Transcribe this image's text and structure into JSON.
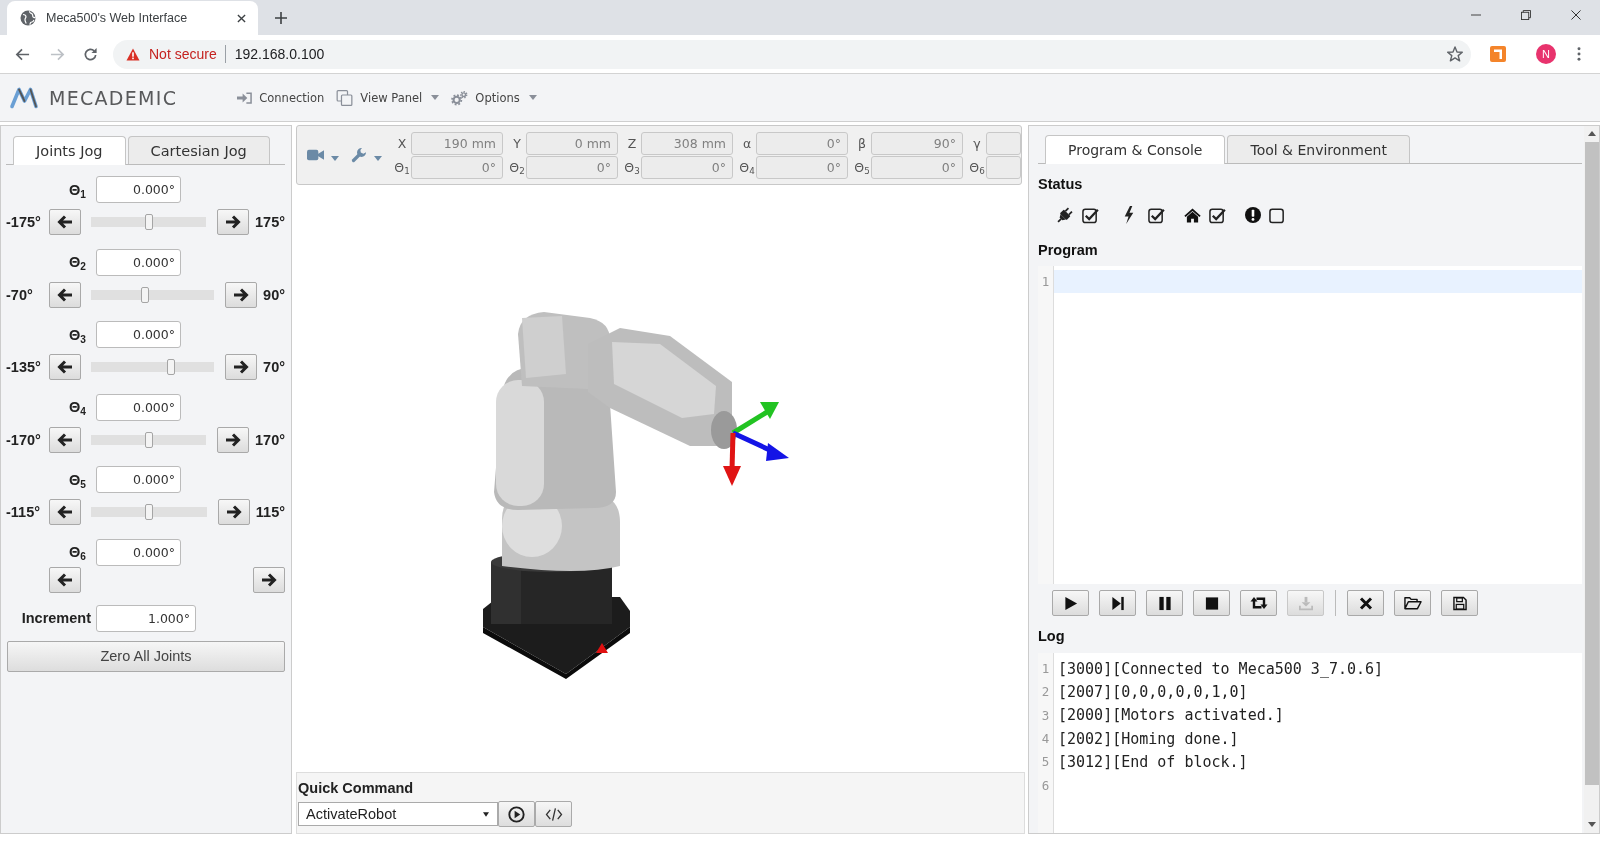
{
  "browser": {
    "tabs": [
      {
        "title": "Meca500's Web Interface",
        "selected": true
      }
    ],
    "forward_disabled": true,
    "security_label": "Not secure",
    "url": "192.168.0.100",
    "profile_initial": "N"
  },
  "app_header": {
    "logo": "MECADEMIC",
    "menu": [
      {
        "label": "Connection",
        "dropdown": false
      },
      {
        "label": "View Panel",
        "dropdown": true
      },
      {
        "label": "Options",
        "dropdown": true
      }
    ]
  },
  "jog_panel": {
    "tabs": [
      {
        "label": "Joints Jog",
        "selected": true
      },
      {
        "label": "Cartesian Jog",
        "selected": false
      }
    ],
    "joints": [
      {
        "label": "Θ$_{1}$",
        "value": "0.000°",
        "min": "-175°",
        "max": "175°",
        "level": 0.5
      },
      {
        "label": "Θ$_{2}$",
        "value": "0.000°",
        "min": "-70°",
        "max": "90°",
        "level": 0.44
      },
      {
        "label": "Θ$_{3}$",
        "value": "0.000°",
        "min": "-135°",
        "max": "70°",
        "level": 0.65
      },
      {
        "label": "Θ$_{4}$",
        "value": "0.000°",
        "min": "-170°",
        "max": "170°",
        "level": 0.5
      },
      {
        "label": "Θ$_{5}$",
        "value": "0.000°",
        "min": "-115°",
        "max": "115°",
        "level": 0.5
      },
      {
        "label": "Θ$_{6}$",
        "value": "0.000°"
      }
    ],
    "increment": {
      "label": "Increment",
      "value": "1.000°"
    },
    "zero_button": "Zero All Joints"
  },
  "viewer": {
    "pose_rows": [
      {
        "fields": [
          {
            "label": "X",
            "value": "190 mm"
          },
          {
            "label": "Y",
            "value": "0 mm"
          },
          {
            "label": "Z",
            "value": "308 mm"
          },
          {
            "label": "α",
            "value": "0°"
          },
          {
            "label": "β",
            "value": "90°"
          },
          {
            "label": "γ"
          }
        ]
      },
      {
        "fields": [
          {
            "label": "Θ$_{1}$",
            "value": "0°"
          },
          {
            "label": "Θ$_{2}$",
            "value": "0°"
          },
          {
            "label": "Θ$_{3}$",
            "value": "0°"
          },
          {
            "label": "Θ$_{4}$",
            "value": "0°"
          },
          {
            "label": "Θ$_{5}$",
            "value": "0°"
          },
          {
            "label": "Θ$_{6}$"
          }
        ]
      }
    ],
    "quick_command": {
      "label": "Quick Command",
      "value": "ActivateRobot"
    }
  },
  "program_panel": {
    "tabs": [
      {
        "label": "Program & Console",
        "selected": true
      },
      {
        "label": "Tool & Environment",
        "selected": false
      }
    ],
    "status": {
      "label": "Status",
      "items": [
        {
          "checked": true
        },
        {
          "checked": true
        },
        {
          "checked": true
        },
        {
          "checked": false
        }
      ]
    },
    "program": {
      "label": "Program",
      "lines": [
        {
          "number": "1",
          "selected": true
        }
      ]
    },
    "controls": [
      {
        "buttons": [
          {
            "disabled": false
          },
          {
            "disabled": false
          },
          {
            "disabled": false
          },
          {
            "disabled": false
          },
          {
            "disabled": false
          },
          {
            "disabled": true
          }
        ]
      },
      {
        "buttons": [
          {
            "disabled": false
          },
          {
            "disabled": false
          },
          {
            "disabled": false
          }
        ]
      }
    ],
    "log": {
      "label": "Log",
      "lines": [
        {
          "number": "1",
          "text": "[3000][Connected to Meca500 3_7.0.6]"
        },
        {
          "number": "2",
          "text": "[2007][0,0,0,0,0,1,0]"
        },
        {
          "number": "3",
          "text": "[2000][Motors activated.]"
        },
        {
          "number": "4",
          "text": "[2002][Homing done.]"
        },
        {
          "number": "5",
          "text": "[3012][End of block.]"
        },
        {
          "number": "6"
        }
      ]
    }
  }
}
